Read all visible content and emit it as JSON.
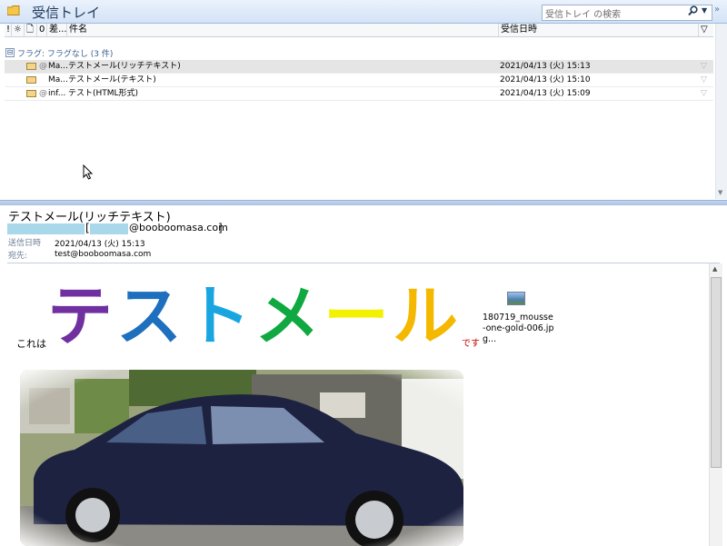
{
  "inbox": {
    "title": "受信トレイ",
    "search_placeholder": "受信トレイ の検索",
    "columns": {
      "importance": "!",
      "reminder": "☼",
      "icon": "🗋",
      "attachment": "0",
      "from": "差...",
      "subject": "件名",
      "received": "受信日時",
      "flag": "▽"
    },
    "group_toggle": "⊟",
    "group_label": "フラグ: フラグなし (3 件)",
    "messages": [
      {
        "from": "Ma...",
        "subject": "テストメール(リッチテキスト)",
        "received": "2021/04/13 (火) 15:13",
        "has_attachment": true,
        "selected": true
      },
      {
        "from": "Ma...",
        "subject": "テストメール(テキスト)",
        "received": "2021/04/13 (火) 15:10",
        "has_attachment": false,
        "selected": false
      },
      {
        "from": "inf...",
        "subject": "テスト(HTML形式)",
        "received": "2021/04/13 (火) 15:09",
        "has_attachment": true,
        "selected": false
      }
    ]
  },
  "reading": {
    "subject": "テストメール(リッチテキスト)",
    "from_bracket_open": "[",
    "from_domain": "@booboomasa.com",
    "from_bracket_close": "]",
    "sent_label": "送信日時",
    "sent_value": "2021/04/13 (火) 15:13",
    "to_label": "宛先:",
    "to_value": "test@booboomasa.com",
    "body_prefix": "これは",
    "body_big": [
      "テ",
      "ス",
      "ト",
      "メ",
      "ー",
      "ル"
    ],
    "body_big_colors": [
      "#7030a0",
      "#1f6fbf",
      "#19a6e0",
      "#10a840",
      "#f2f200",
      "#f5b800"
    ],
    "body_suffix": "です",
    "attachment_name": "180719_mousse-one-gold-006.jpg..."
  },
  "colors": {
    "header_bg": "#d4e3f6",
    "title_color": "#1e395b",
    "selected_row": "#e5e5e5",
    "redaction": "#a8d8ea"
  }
}
